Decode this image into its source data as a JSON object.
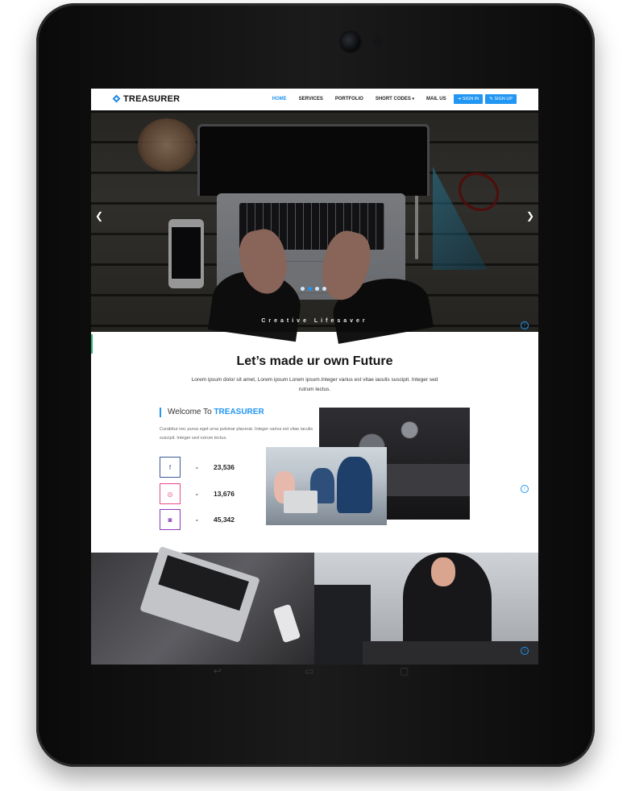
{
  "nav": {
    "logo": "TREASURER",
    "links": [
      "HOME",
      "SERVICES",
      "PORTFOLIO",
      "SHORT CODES",
      "MAIL US"
    ],
    "dropdown_caret": "▾",
    "sign_in": "SIGN IN",
    "sign_up": "SIGN UP"
  },
  "hero": {
    "tagline": "Creative Lifesaver",
    "prev_icon": "chevron-left-icon",
    "next_icon": "chevron-right-icon",
    "active_slide": 1,
    "slide_count": 4
  },
  "main": {
    "headline": "Let’s made ur own Future",
    "intro": "Lorem ipsum dolor sit amet, Lorem ipsum Lorem ipsum.Integer varius est vitae iaculis suscipit. Integer sed rutrum lectus.",
    "welcome_prefix": "Welcome To ",
    "welcome_brand": "TREASURER",
    "welcome_text": "Curabitur nec purus eget urna pulvinar placerat. Integer varius est vitae iaculis suscipit. Integer sed rutrum lectus."
  },
  "stats": [
    {
      "icon": "facebook-icon",
      "glyph": "f",
      "color": "#3b5998",
      "dash": "-",
      "value": "23,536"
    },
    {
      "icon": "dribbble-icon",
      "glyph": "◎",
      "color": "#ea4c89",
      "dash": "-",
      "value": "13,676"
    },
    {
      "icon": "instagram-icon",
      "glyph": "◙",
      "color": "#8a3ab9",
      "dash": "-",
      "value": "45,342"
    }
  ],
  "colors": {
    "accent": "#2196f3",
    "text_dark": "#151515",
    "bezel": "#111111"
  }
}
